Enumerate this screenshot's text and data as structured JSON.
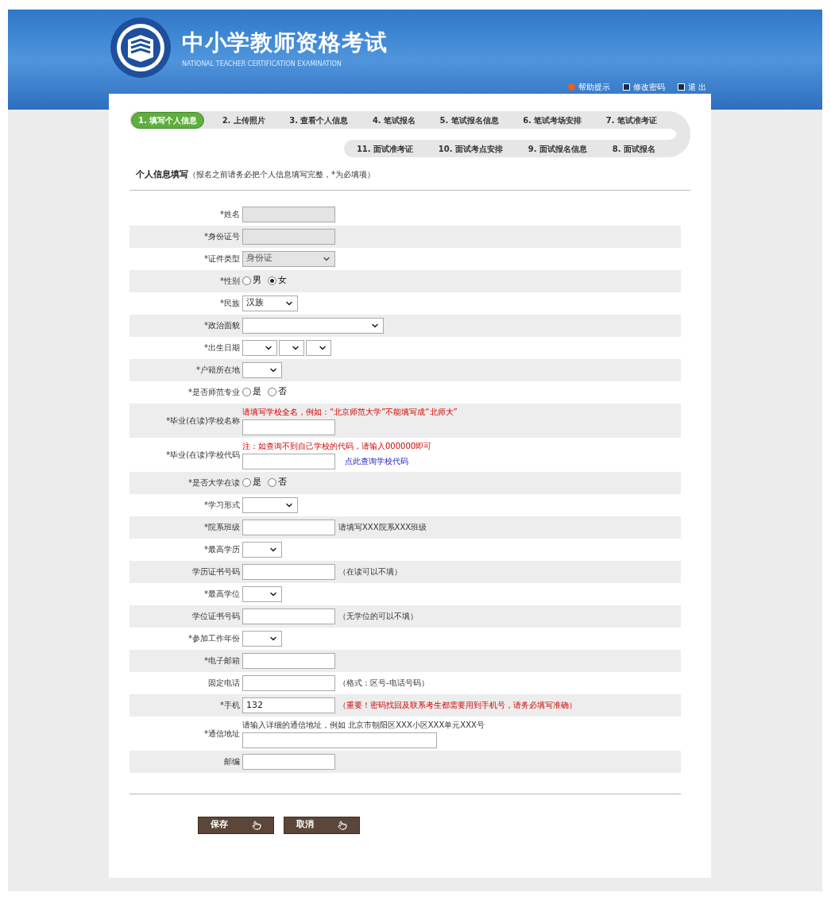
{
  "header": {
    "title": "中小学教师资格考试",
    "subtitle": "NATIONAL TEACHER CERTIFICATION EXAMINATION",
    "links": [
      {
        "label": "帮助提示"
      },
      {
        "label": "修改密码"
      },
      {
        "label": "退 出"
      }
    ]
  },
  "steps": [
    {
      "label": "1. 填写个人信息",
      "selected": true
    },
    {
      "label": "2. 上传照片",
      "selected": false
    },
    {
      "label": "3. 查看个人信息",
      "selected": false
    },
    {
      "label": "4. 笔试报名",
      "selected": false
    },
    {
      "label": "5. 笔试报名信息",
      "selected": false
    },
    {
      "label": "6. 笔试考场安排",
      "selected": false
    },
    {
      "label": "7. 笔试准考证",
      "selected": false
    },
    {
      "label": "11. 面试准考证",
      "selected": false
    },
    {
      "label": "10. 面试考点安排",
      "selected": false
    },
    {
      "label": "9. 面试报名信息",
      "selected": false
    },
    {
      "label": "8. 面试报名",
      "selected": false
    }
  ],
  "section": {
    "title": "个人信息填写",
    "note": "（报名之前请务必把个人信息填写完整，*为必填项）"
  },
  "rows": [
    {
      "kind": "input",
      "label": "*姓名",
      "disabled": true
    },
    {
      "kind": "input",
      "label": "*身份证号",
      "disabled": true
    },
    {
      "kind": "select",
      "label": "*证件类型",
      "value": "身份证",
      "disabled": true
    },
    {
      "kind": "radio",
      "label": "*性别",
      "options": [
        {
          "label": "男",
          "selected": false
        },
        {
          "label": "女",
          "selected": true
        }
      ]
    },
    {
      "kind": "select",
      "label": "*民族",
      "value": "汉族",
      "disabled": false
    },
    {
      "kind": "select",
      "label": "*政治面貌",
      "disabled": false
    },
    {
      "kind": "date",
      "label": "*出生日期"
    },
    {
      "kind": "select",
      "label": "*户籍所在地",
      "disabled": false
    },
    {
      "kind": "radio",
      "label": "*是否师范专业",
      "options": [
        {
          "label": "是",
          "selected": false
        },
        {
          "label": "否",
          "selected": false
        }
      ]
    },
    {
      "kind": "input",
      "label": "*毕业(在读)学校名称",
      "disabled": false,
      "note": {
        "text": "请填写学校全名，例如：“北京师范大学”不能填写成“北师大”",
        "warning": true
      }
    },
    {
      "kind": "input",
      "label": "*毕业(在读)学校代码",
      "disabled": false,
      "note": {
        "text": "注：如查询不到自己学校的代码，请输入000000即可",
        "warning": true
      },
      "link": "点此查询学校代码"
    },
    {
      "kind": "radio",
      "label": "*是否大学在读",
      "options": [
        {
          "label": "是",
          "selected": false
        },
        {
          "label": "否",
          "selected": false
        }
      ]
    },
    {
      "kind": "select",
      "label": "*学习形式",
      "disabled": false
    },
    {
      "kind": "input",
      "label": "*院系班级",
      "disabled": false,
      "hint": {
        "text": "请填写XXX院系XXX班级",
        "warning": false
      }
    },
    {
      "kind": "select",
      "label": "*最高学历",
      "disabled": false
    },
    {
      "kind": "input",
      "label": "学历证书号码",
      "disabled": false,
      "hint": {
        "text": "（在读可以不填）",
        "warning": false
      }
    },
    {
      "kind": "select",
      "label": "*最高学位",
      "disabled": false
    },
    {
      "kind": "input",
      "label": "学位证书号码",
      "disabled": false,
      "hint": {
        "text": "（无学位的可以不填）",
        "warning": false
      }
    },
    {
      "kind": "select",
      "label": "*参加工作年份",
      "disabled": false
    },
    {
      "kind": "input",
      "label": "*电子邮箱",
      "disabled": false
    },
    {
      "kind": "input",
      "label": "固定电话",
      "disabled": false,
      "hint": {
        "text": "（格式：区号-电话号码）",
        "warning": false
      }
    },
    {
      "kind": "input",
      "label": "*手机",
      "value": "132",
      "disabled": false,
      "hint": {
        "text": "（重要！密码找回及联系考生都需要用到手机号，请务必填写准确）",
        "warning": true
      }
    },
    {
      "kind": "input",
      "label": "*通信地址",
      "disabled": false,
      "note": {
        "text": "请输入详细的通信地址，例如 北京市朝阳区XXX小区XXX单元XXX号",
        "warning": false
      }
    },
    {
      "kind": "input",
      "label": "邮编",
      "disabled": false
    }
  ],
  "buttons": [
    {
      "label": "保存"
    },
    {
      "label": "取消"
    }
  ]
}
